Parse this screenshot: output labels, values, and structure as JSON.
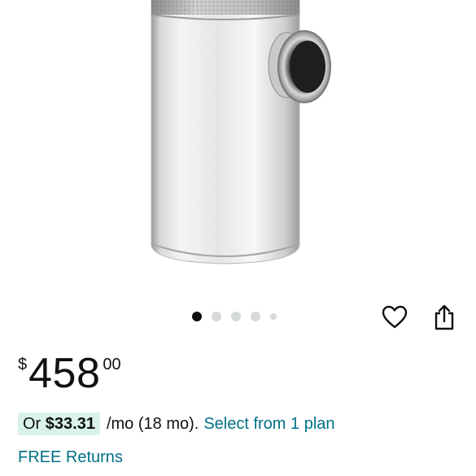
{
  "product": {
    "image_icon": "stainless-steel-cylinder-product-image"
  },
  "carousel": {
    "active_index": 1,
    "count": 5
  },
  "actions": {
    "wishlist_icon": "heart-icon",
    "share_icon": "share-icon"
  },
  "price": {
    "symbol": "$",
    "whole": "458",
    "fraction": "00"
  },
  "installment": {
    "or_label": "Or",
    "amount": "$33.31",
    "term": "/mo (18 mo).",
    "plan_link": "Select from 1 plan"
  },
  "returns": {
    "label": "FREE Returns"
  },
  "colors": {
    "link": "#007185",
    "badge_bg": "#d9f2ec",
    "text": "#0f1111"
  }
}
